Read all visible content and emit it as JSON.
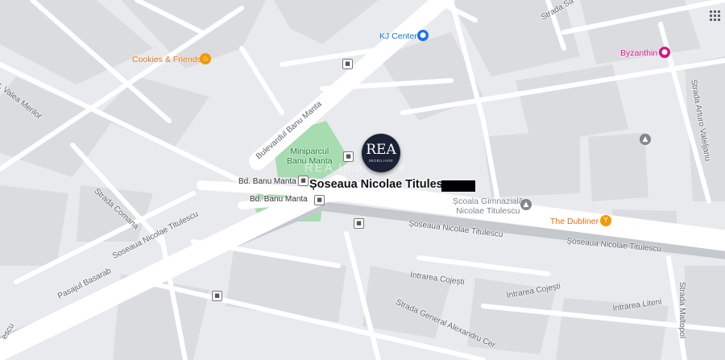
{
  "map": {
    "address_label": "Șoseaua Nicolae Titulescu",
    "watermark": "REA Imobiliare",
    "marker": {
      "logo": "REA",
      "subtitle": "IMOBILIARE",
      "color": "#1c2236"
    },
    "colors": {
      "land": "#e8eaed",
      "block": "#dadce0",
      "road": "#ffffff",
      "park": "#a7dbb0",
      "railway": "#aeb3b9"
    },
    "streets": {
      "valea_merilor": "Str. Valea Merilor",
      "bulevardul_banu_manta": "Bulevardul Banu Manta",
      "bd_banu_manta_1": "Bd. Banu Manta",
      "bd_banu_manta_2": "Bd. Banu Manta",
      "strada_comana": "Strada Comana",
      "soseaua_nt_left": "Soseaua Nicolae Titulescu",
      "pasajul_basarab": "Pasajul Basarab",
      "soseaua_nt_mid": "Șoseaua Nicolae Titulescu",
      "soseaua_nt_right": "Șoseaua Nicolae Titulescu",
      "intrarea_cojesti_1": "Intrarea Cojești",
      "intrarea_cojesti_2": "Intrarea Cojești",
      "intrarea_liteni": "Intrarea Liteni",
      "strada_general": "Strada General Alexandru Cer",
      "strada_sa": "Strada Sa",
      "strada_arturo": "Strada Arturo Vateljanu",
      "strada_maltopol": "Strada Maltopol",
      "left_edge": "escu"
    },
    "pois": {
      "cookies": "Cookies & Friends",
      "kj_center": "KJ Center",
      "byzanthin": "Byzanthin",
      "miniparcul": "Miniparcul\nBanu Manta",
      "scoala": "Școala Gimnazială\nNicolae Titulescu",
      "dubliner": "The Dubliner"
    },
    "icons": {
      "restaurant": "restaurant-icon",
      "shopping": "shopping-icon",
      "school": "school-icon",
      "bar": "bar-icon",
      "bus_stop": "bus-stop-icon",
      "apps": "apps-grid-icon"
    }
  }
}
